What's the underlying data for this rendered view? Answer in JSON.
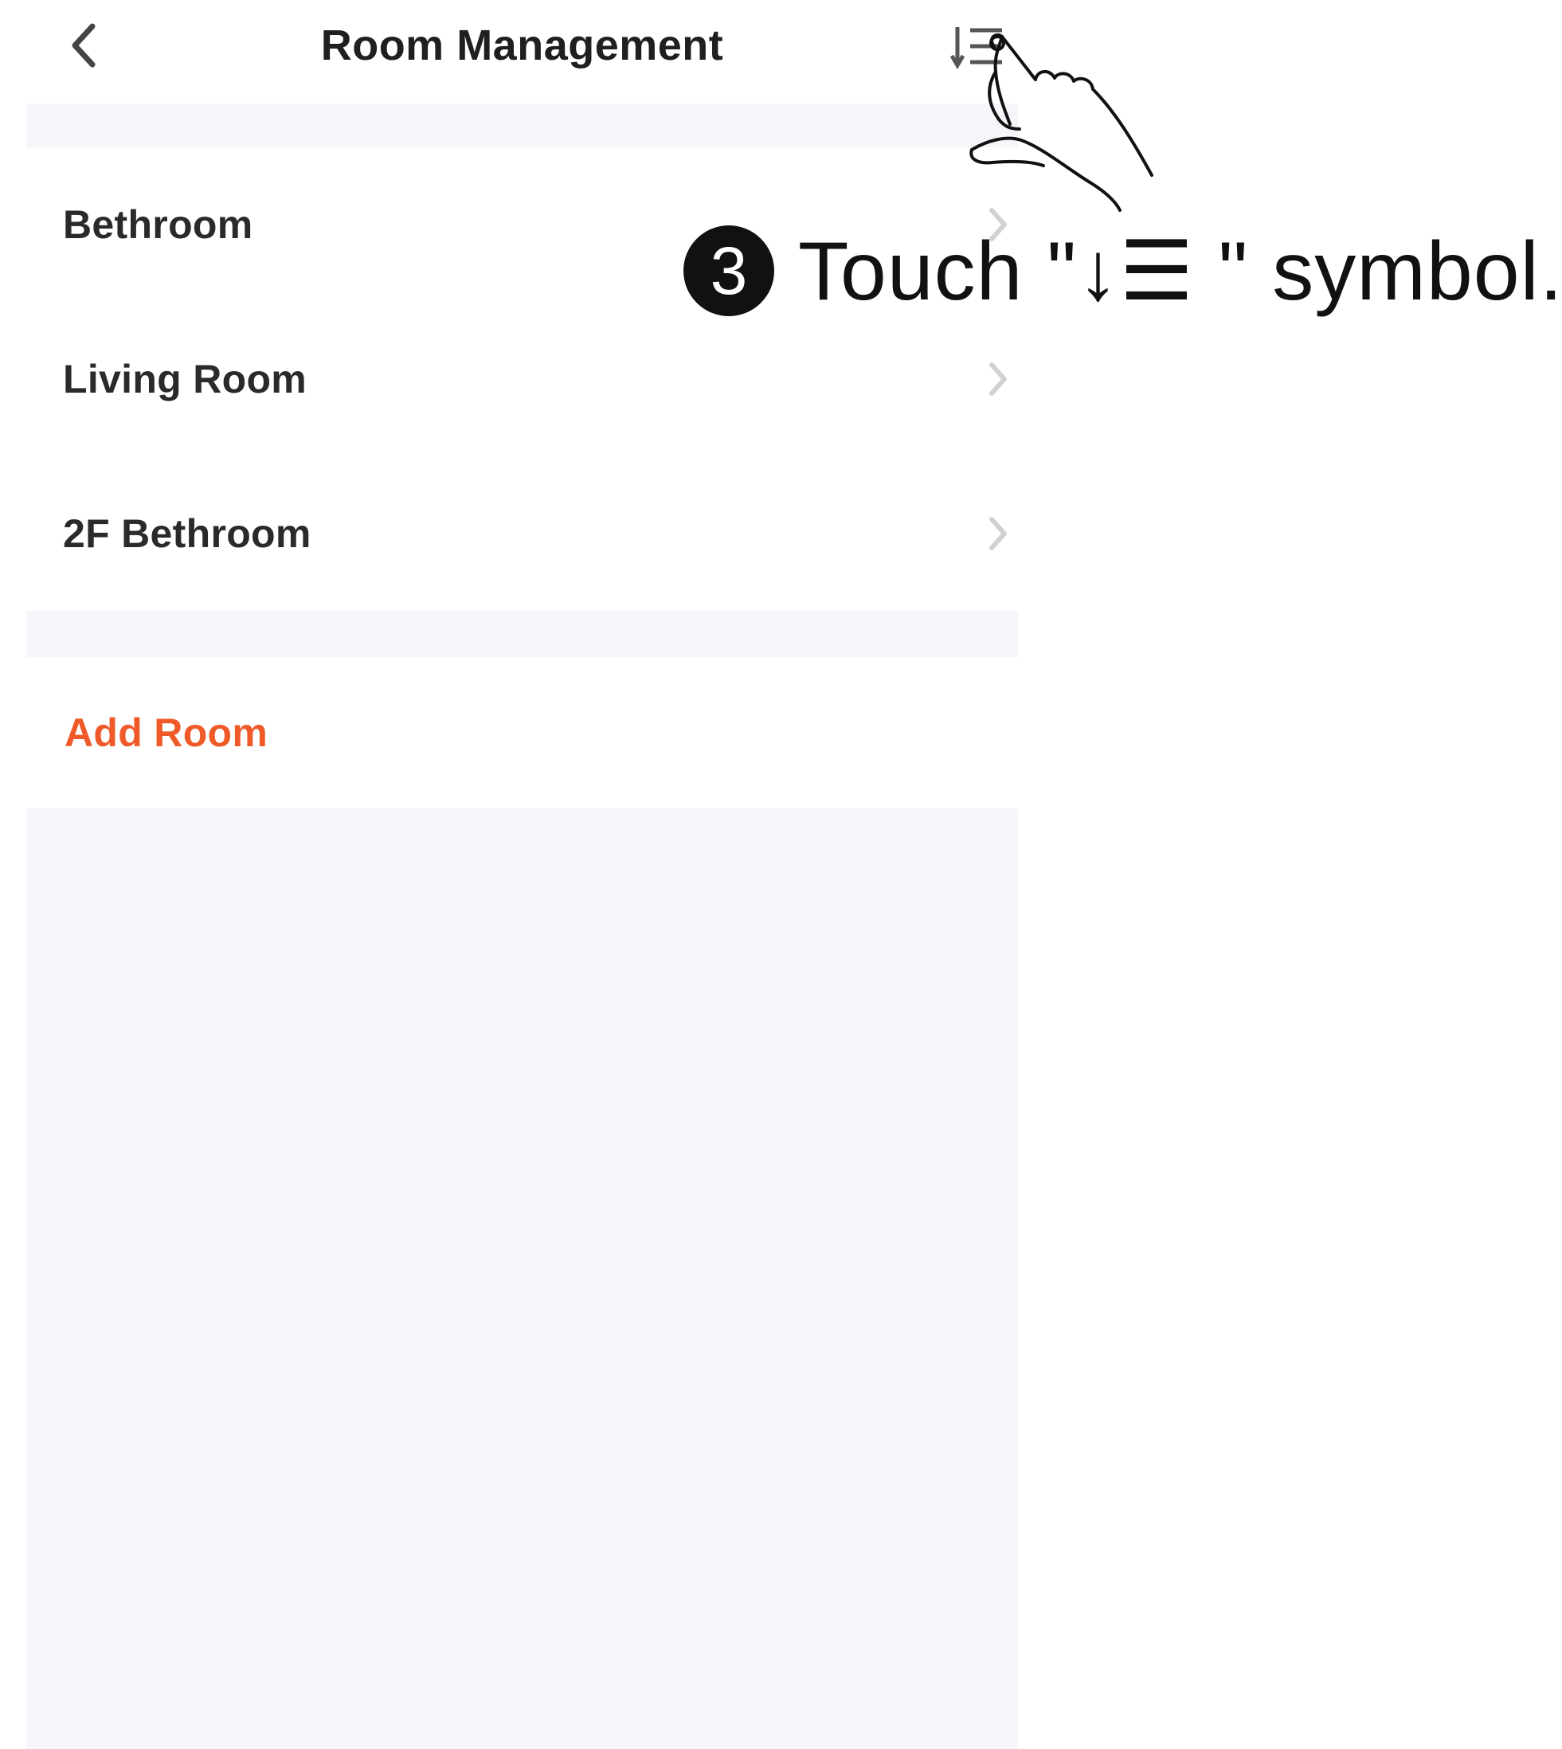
{
  "header": {
    "title": "Room Management",
    "back_icon": "chevron-left-icon",
    "sort_icon": "sort-list-icon"
  },
  "rooms": [
    {
      "label": "Bethroom"
    },
    {
      "label": "Living Room"
    },
    {
      "label": "2F Bethroom"
    }
  ],
  "add_room": {
    "label": "Add Room",
    "color": "#f05a28"
  },
  "annotation": {
    "step": "3",
    "text": "Touch \"↓☰ \" symbol."
  },
  "colors": {
    "background": "#f5f6fa",
    "card": "#ffffff",
    "accent": "#f05a28"
  }
}
